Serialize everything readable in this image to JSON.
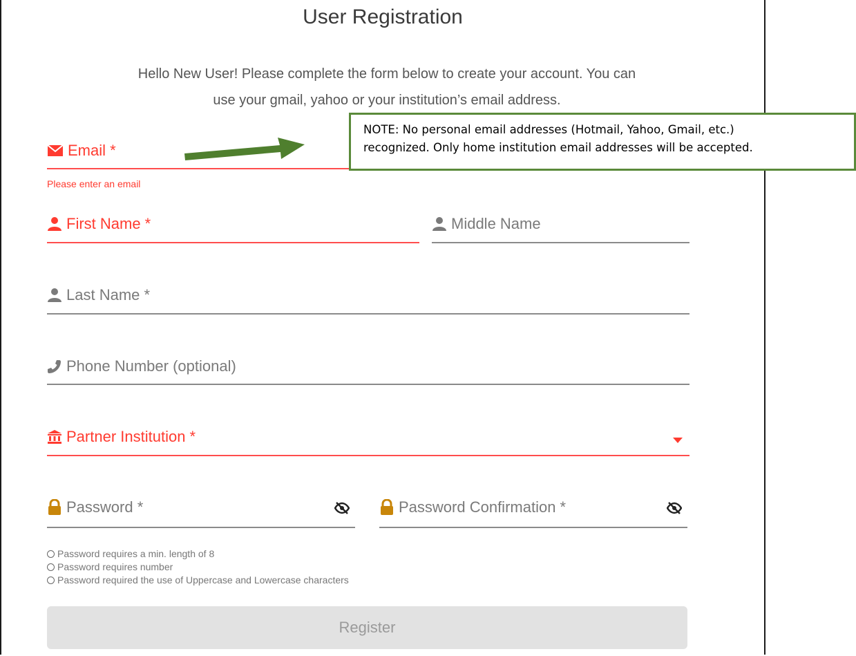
{
  "page": {
    "title": "User Registration",
    "intro_line1": "Hello New User! Please complete the form below to create your account. You can",
    "intro_line2": "use your gmail, yahoo or your institution’s email address."
  },
  "form": {
    "email": {
      "label": "Email *",
      "error": "Please enter an email",
      "icon": "envelope-icon",
      "state": "error"
    },
    "first_name": {
      "label": "First Name *",
      "icon": "user-icon",
      "state": "error"
    },
    "middle_name": {
      "label": "Middle Name",
      "icon": "user-icon"
    },
    "last_name": {
      "label": "Last Name *",
      "icon": "user-icon"
    },
    "phone": {
      "label": "Phone Number (optional)",
      "icon": "phone-icon"
    },
    "institution": {
      "label": "Partner Institution *",
      "icon": "institution-icon",
      "state": "error"
    },
    "password": {
      "label": "Password *",
      "icon": "lock-icon"
    },
    "password_confirmation": {
      "label": "Password Confirmation *",
      "icon": "lock-icon"
    },
    "password_rules": [
      "Password requires a min. length of 8",
      "Password requires number",
      "Password required the use of Uppercase and Lowercase characters"
    ],
    "register_label": "Register"
  },
  "annotation": {
    "note_line1": "NOTE: No personal email addresses (Hotmail, Yahoo, Gmail, etc.)",
    "note_line2": "recognized. Only home institution email addresses will be accepted."
  },
  "colors": {
    "error": "#ff3b30",
    "neutral": "#7a7a7a",
    "lock": "#c8860a",
    "note_border": "#5a8a3a",
    "button_bg": "#e2e2e2"
  }
}
